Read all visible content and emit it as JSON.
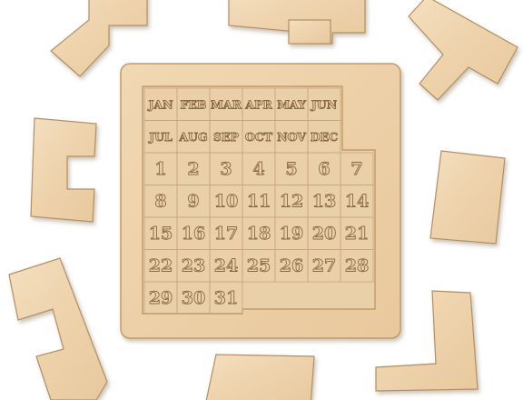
{
  "colors": {
    "wood_light": "#f1d9b6",
    "wood_mid": "#e6c9a0",
    "wood_edge": "#c9a476",
    "engrave": "#8a6a45",
    "grid_line": "#c8a57a"
  },
  "calendar": {
    "months_row1": [
      "JAN",
      "FEB",
      "MAR",
      "APR",
      "MAY",
      "JUN"
    ],
    "months_row2": [
      "JUL",
      "AUG",
      "SEP",
      "OCT",
      "NOV",
      "DEC"
    ],
    "days": [
      "1",
      "2",
      "3",
      "4",
      "5",
      "6",
      "7",
      "8",
      "9",
      "10",
      "11",
      "12",
      "13",
      "14",
      "15",
      "16",
      "17",
      "18",
      "19",
      "20",
      "21",
      "22",
      "23",
      "24",
      "25",
      "26",
      "27",
      "28",
      "29",
      "30",
      "31"
    ]
  },
  "pieces": [
    {
      "name": "piece-top-left-z"
    },
    {
      "name": "piece-top-center-t"
    },
    {
      "name": "piece-top-right-l"
    },
    {
      "name": "piece-left-c"
    },
    {
      "name": "piece-right-rect"
    },
    {
      "name": "piece-bottom-left-l"
    },
    {
      "name": "piece-bottom-center-rect"
    },
    {
      "name": "piece-bottom-right-l"
    }
  ]
}
